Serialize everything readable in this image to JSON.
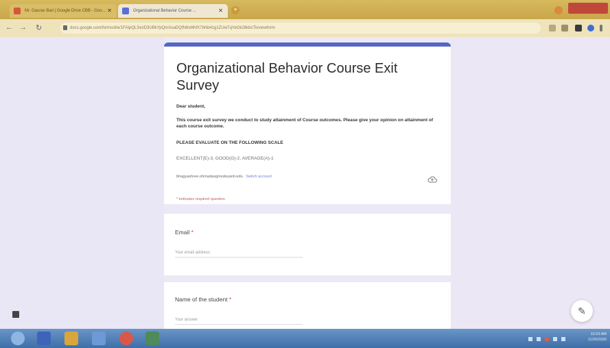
{
  "browser": {
    "tabs": [
      {
        "label": "Mr. Gaurav Bari | Google Drive CBB - Goo...",
        "active": false
      },
      {
        "label": "Organizational Behavior Course ...",
        "active": false
      }
    ],
    "address": "docs.google.com/forms/d/e/1FAIpQLSezD3UBkYpQmXoaDQfN6vMhfX7bNb4zg1ZUwTqYeOk28kbsTk/viewform",
    "accent": "#c9a64a"
  },
  "form": {
    "title": "Organizational Behavior Course Exit Survey",
    "greeting": "Dear student,",
    "intro": "This course exit survey we conduct to study attainment of Course outcomes. Please give your opinion on attainment of each course outcome.",
    "scale_heading": "PLEASE EVALUATE ON THE FOLLOWING SCALE",
    "scale_values": "EXCELLENT(E)-3,  GOOD(G)-2,  AVERAGE(A)-1",
    "account_email": "bhagyashree.ohmadasgmodeyanti.edu",
    "switch_account": "Switch account",
    "required_note": "* Indicates required question",
    "theme_color": "#5566c4"
  },
  "questions": [
    {
      "label": "Email",
      "required_mark": "*",
      "placeholder": "Your email address"
    },
    {
      "label": "Name of the student",
      "required_mark": "*",
      "placeholder": "Your answer"
    }
  ],
  "icons": {
    "cloud": "cloud-save-icon",
    "fab": "edit-pencil-icon"
  },
  "system": {
    "clock_time": "10:23 AM",
    "clock_date": "11/20/2020"
  }
}
